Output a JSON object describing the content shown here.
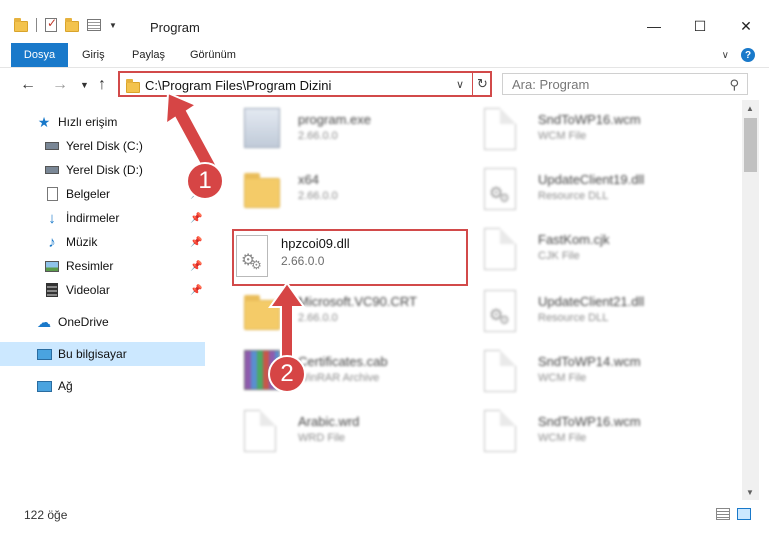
{
  "window": {
    "title": "Program",
    "controls": {
      "minimize": "—",
      "maximize": "☐",
      "close": "✕"
    }
  },
  "ribbon": {
    "tabs": [
      "Dosya",
      "Giriş",
      "Paylaş",
      "Görünüm"
    ],
    "help": "?"
  },
  "navigation": {
    "address": "C:\\Program Files\\Program Dizini",
    "search_placeholder": "Ara: Program"
  },
  "sidebar": {
    "items": [
      {
        "label": "Hızlı erişim",
        "icon": "star-icon"
      },
      {
        "label": "Yerel Disk (C:)",
        "icon": "drive-icon"
      },
      {
        "label": "Yerel Disk (D:)",
        "icon": "drive-icon"
      },
      {
        "label": "Belgeler",
        "icon": "documents-icon"
      },
      {
        "label": "İndirmeler",
        "icon": "download-icon"
      },
      {
        "label": "Müzik",
        "icon": "music-icon"
      },
      {
        "label": "Resimler",
        "icon": "pictures-icon"
      },
      {
        "label": "Videolar",
        "icon": "video-icon"
      },
      {
        "label": "OneDrive",
        "icon": "cloud-icon"
      },
      {
        "label": "Bu bilgisayar",
        "icon": "computer-icon"
      },
      {
        "label": "Ağ",
        "icon": "network-icon"
      }
    ]
  },
  "files": {
    "left": [
      {
        "name": "program.exe",
        "sub": "2.66.0.0"
      },
      {
        "name": "x64",
        "sub": "2.66.0.0"
      },
      {
        "name": "hpzcoi09.dll",
        "sub": "2.66.0.0"
      },
      {
        "name": "Microsoft.VC90.CRT",
        "sub": "2.66.0.0"
      },
      {
        "name": "Certificates.cab",
        "sub": "WinRAR Archive"
      },
      {
        "name": "Arabic.wrd",
        "sub": "WRD File"
      }
    ],
    "right": [
      {
        "name": "SndToWP16.wcm",
        "sub": "WCM File"
      },
      {
        "name": "UpdateClient19.dll",
        "sub": "Resource DLL"
      },
      {
        "name": "FastKom.cjk",
        "sub": "CJK File"
      },
      {
        "name": "UpdateClient21.dll",
        "sub": "Resource DLL"
      },
      {
        "name": "SndToWP14.wcm",
        "sub": "WCM File"
      },
      {
        "name": "SndToWP16.wcm",
        "sub": "WCM File"
      }
    ]
  },
  "status": {
    "count": "122 öğe"
  },
  "annotations": {
    "step1": "1",
    "step2": "2",
    "color": "#d64545"
  }
}
